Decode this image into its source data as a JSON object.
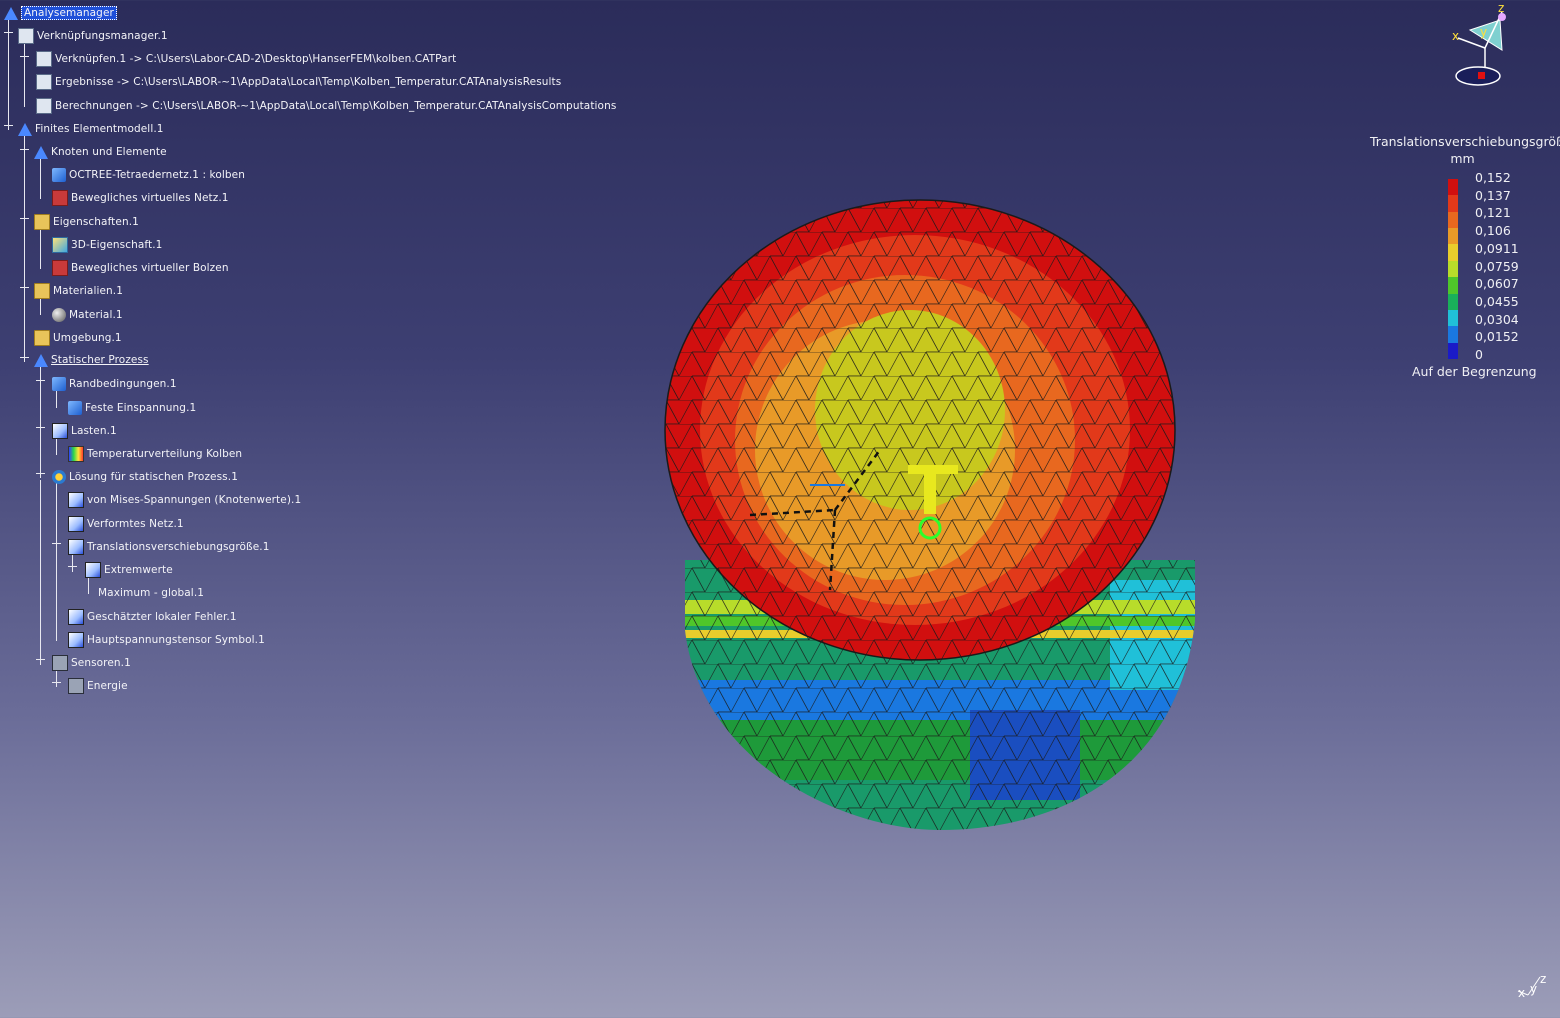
{
  "tree": {
    "items": [
      {
        "label": "Analysemanager",
        "icon": "analysis-manager-icon"
      },
      {
        "label": "Verknüpfungsmanager.1",
        "icon": "link-manager-icon"
      },
      {
        "label": "Verknüpfen.1 -> C:\\Users\\Labor-CAD-2\\Desktop\\HanserFEM\\kolben.CATPart",
        "icon": "link-icon"
      },
      {
        "label": "Ergebnisse -> C:\\Users\\LABOR-~1\\AppData\\Local\\Temp\\Kolben_Temperatur.CATAnalysisResults",
        "icon": "results-link-icon"
      },
      {
        "label": "Berechnungen -> C:\\Users\\LABOR-~1\\AppData\\Local\\Temp\\Kolben_Temperatur.CATAnalysisComputations",
        "icon": "computations-link-icon"
      },
      {
        "label": "Finites Elementmodell.1",
        "icon": "fem-model-icon"
      },
      {
        "label": "Knoten und Elemente",
        "icon": "nodes-elements-icon"
      },
      {
        "label": "OCTREE-Tetraedernetz.1 : kolben",
        "icon": "tetra-mesh-icon"
      },
      {
        "label": "Bewegliches virtuelles Netz.1",
        "icon": "virtual-mesh-icon"
      },
      {
        "label": "Eigenschaften.1",
        "icon": "folder-icon"
      },
      {
        "label": "3D-Eigenschaft.1",
        "icon": "property-3d-icon"
      },
      {
        "label": "Bewegliches virtueller Bolzen",
        "icon": "virtual-bolt-icon"
      },
      {
        "label": "Materialien.1",
        "icon": "folder-icon"
      },
      {
        "label": "Material.1",
        "icon": "material-icon"
      },
      {
        "label": "Umgebung.1",
        "icon": "folder-icon"
      },
      {
        "label": "Statischer Prozess",
        "icon": "static-case-icon"
      },
      {
        "label": "Randbedingungen.1",
        "icon": "restraints-icon"
      },
      {
        "label": "Feste Einspannung.1",
        "icon": "clamp-icon"
      },
      {
        "label": "Lasten.1",
        "icon": "loads-icon"
      },
      {
        "label": "Temperaturverteilung Kolben",
        "icon": "temperature-field-icon"
      },
      {
        "label": "Lösung für statischen Prozess.1",
        "icon": "solution-icon"
      },
      {
        "label": "von Mises-Spannungen (Knotenwerte).1",
        "icon": "image-icon"
      },
      {
        "label": "Verformtes Netz.1",
        "icon": "image-icon"
      },
      {
        "label": "Translationsverschiebungsgröße.1",
        "icon": "image-icon"
      },
      {
        "label": "Extremwerte",
        "icon": "extrema-icon"
      },
      {
        "label": "Maximum - global.1",
        "icon": ""
      },
      {
        "label": "Geschätzter lokaler Fehler.1",
        "icon": "image-icon"
      },
      {
        "label": "Hauptspannungstensor Symbol.1",
        "icon": "image-icon"
      },
      {
        "label": "Sensoren.1",
        "icon": "sensors-icon"
      },
      {
        "label": "Energie",
        "icon": "energy-sensor-icon"
      }
    ]
  },
  "legend": {
    "title": "Translationsverschiebungsgröß",
    "unit": "mm",
    "ticks": [
      "0,152",
      "0,137",
      "0,121",
      "0,106",
      "0,0911",
      "0,0759",
      "0,0607",
      "0,0455",
      "0,0304",
      "0,0152",
      "0"
    ],
    "colors": [
      "#d10f0f",
      "#e2391a",
      "#e8681f",
      "#e89a28",
      "#e8cd2c",
      "#b8dc2a",
      "#4fc62a",
      "#19b05a",
      "#20c0d8",
      "#1a78e0",
      "#1a1ac8"
    ],
    "footer": "Auf der Begrenzung"
  },
  "compass": {
    "x": "x",
    "y": "y",
    "z": "z"
  },
  "axes_small": {
    "x": "x",
    "y": "y",
    "z": "z"
  }
}
